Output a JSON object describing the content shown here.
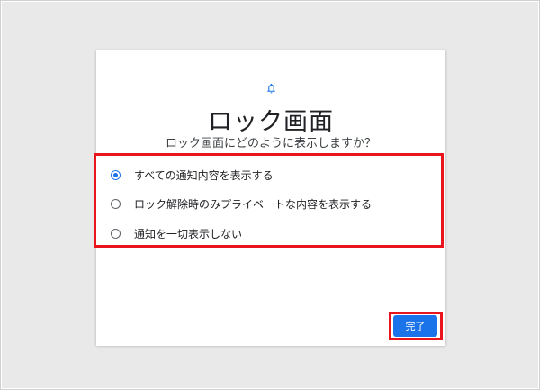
{
  "dialog": {
    "icon": "bell-icon",
    "title": "ロック画面",
    "subtitle": "ロック画面にどのように表示しますか？",
    "options": [
      {
        "label": "すべての通知内容を表示する",
        "selected": true
      },
      {
        "label": "ロック解除時のみプライベートな内容を表示する",
        "selected": false
      },
      {
        "label": "通知を一切表示しない",
        "selected": false
      }
    ],
    "done_label": "完了"
  },
  "colors": {
    "accent": "#1a73e8",
    "highlight": "#e8161c"
  }
}
